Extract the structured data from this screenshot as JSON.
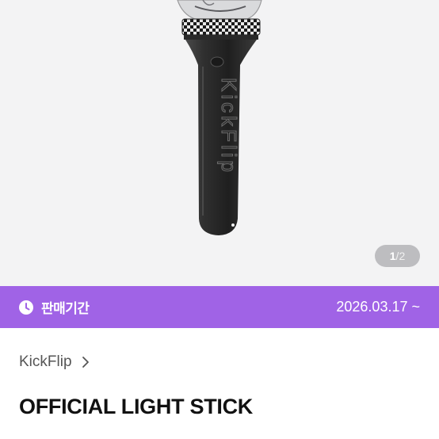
{
  "gallery": {
    "image": "light-stick-product-photo",
    "engraving": "KickFlip",
    "pager": {
      "current": "1",
      "separator": "/",
      "total": "2"
    }
  },
  "sale": {
    "icon": "clock-icon",
    "label": "판매기간",
    "date": "2026.03.17 ~",
    "color": "#a063e6"
  },
  "product": {
    "brand": "KickFlip",
    "brand_icon": "chevron-right-icon",
    "title": "OFFICIAL LIGHT STICK"
  }
}
